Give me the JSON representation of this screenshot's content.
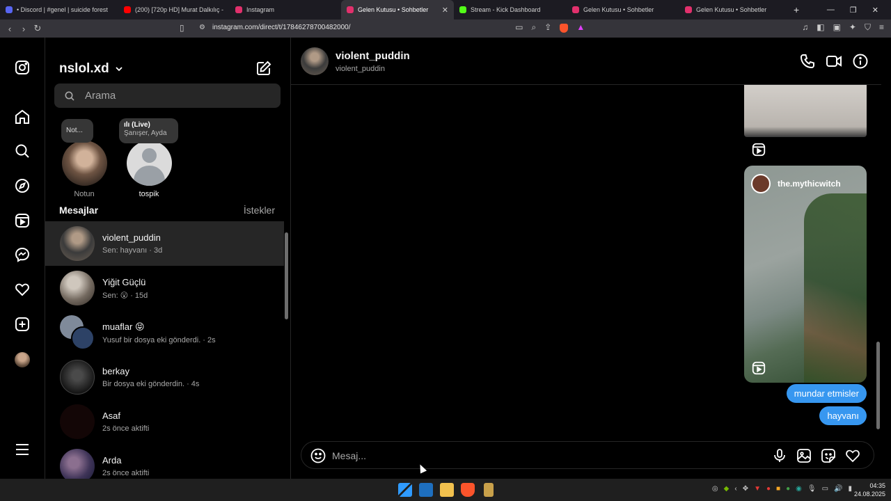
{
  "browser": {
    "tabs": [
      {
        "label": "• Discord | #genel | suicide forest",
        "color": "#5865f2"
      },
      {
        "label": "(200) [720p HD] Murat Dalkılıç -",
        "color": "#ff0000"
      },
      {
        "label": "Instagram",
        "color": "#e1306c"
      },
      {
        "label": "Gelen Kutusu • Sohbetler",
        "color": "#e1306c"
      },
      {
        "label": "Stream - Kick Dashboard",
        "color": "#53fc18"
      },
      {
        "label": "Gelen Kutusu • Sohbetler",
        "color": "#e1306c"
      },
      {
        "label": "Gelen Kutusu • Sohbetler",
        "color": "#e1306c"
      }
    ],
    "url": "instagram.com/direct/t/17846278700482000/"
  },
  "sidebar": {
    "account": "nslol.xd",
    "search_placeholder": "Arama",
    "notes": [
      {
        "bubble": "Not...",
        "name": "Notun"
      },
      {
        "bubble_badge": "(Live)",
        "bubble_sub": "Şanışer, Ayda",
        "name": "tospik"
      }
    ],
    "section_title": "Mesajlar",
    "requests_label": "İstekler",
    "conversations": [
      {
        "name": "violent_puddin",
        "sub": "Sen: hayvanı · 3d",
        "color": "#5a4a3a"
      },
      {
        "name": "Yiğit Güçlü",
        "sub": "Sen: 😮 · 15d",
        "color": "#6b6158"
      },
      {
        "name": "muaflar 😝",
        "sub": "Yusuf bir dosya eki gönderdi. · 2s",
        "color": "#3a4e6a"
      },
      {
        "name": "berkay",
        "sub": "Bir dosya eki gönderdin. · 4s",
        "color": "#2a2a2a"
      },
      {
        "name": "Asaf",
        "sub": "2s önce aktifti",
        "color": "#1a0a0a"
      },
      {
        "name": "Arda",
        "sub": "2s önce aktifti",
        "color": "#4a3a5a"
      }
    ]
  },
  "chat": {
    "name": "violent_puddin",
    "username": "violent_puddin",
    "shared_reel_user": "the.mythicwitch",
    "messages": [
      "mundar etmisler",
      "hayvanı"
    ],
    "composer_placeholder": "Mesaj..."
  },
  "taskbar": {
    "time": "04:35",
    "date": "24.08.2025"
  }
}
